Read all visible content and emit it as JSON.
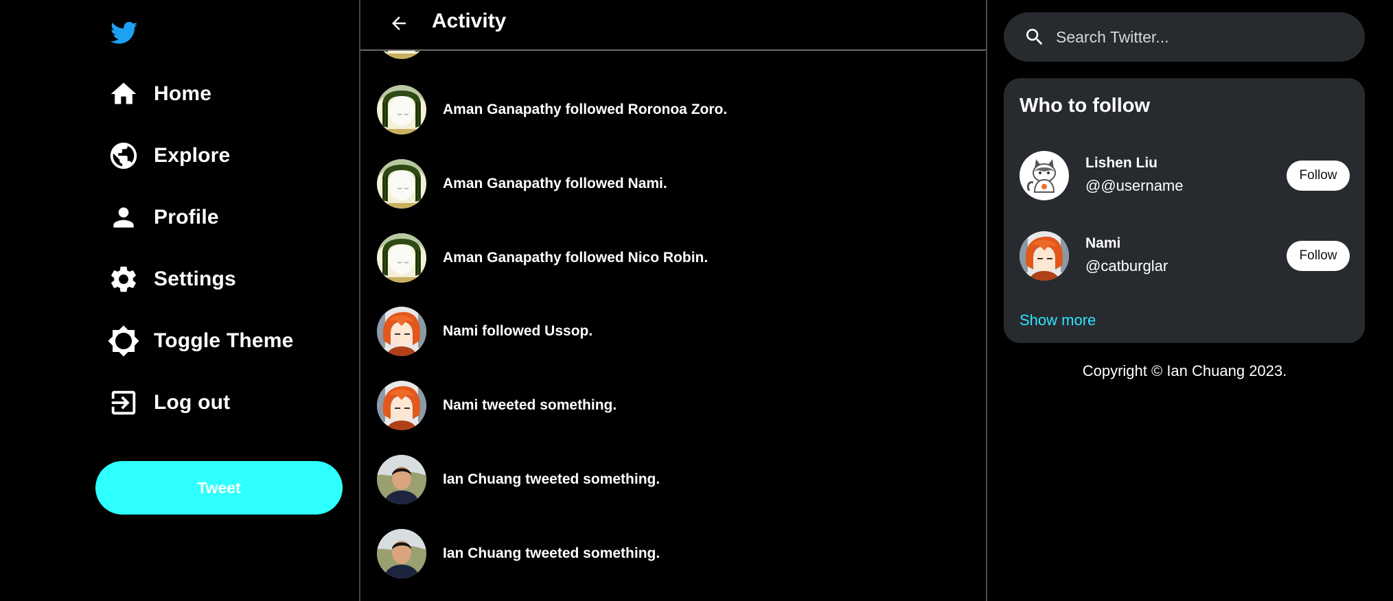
{
  "colors": {
    "background": "#000000",
    "accent": "#2effff",
    "panel": "#272b30",
    "link": "#2ee6ff",
    "logo": "#1da1f2"
  },
  "sidebar": {
    "logo_icon": "twitter-bird-icon",
    "items": [
      {
        "label": "Home",
        "icon": "home-icon"
      },
      {
        "label": "Explore",
        "icon": "globe-icon"
      },
      {
        "label": "Profile",
        "icon": "person-icon"
      },
      {
        "label": "Settings",
        "icon": "gear-icon"
      },
      {
        "label": "Toggle Theme",
        "icon": "brightness-icon"
      },
      {
        "label": "Log out",
        "icon": "logout-icon"
      }
    ],
    "tweet_label": "Tweet"
  },
  "main": {
    "title": "Activity",
    "back_icon": "arrow-left-icon",
    "activities": [
      {
        "text": "Aman Ganapathy followed Roronoa Zoro.",
        "avatar": "aman-avatar"
      },
      {
        "text": "Aman Ganapathy followed Nami.",
        "avatar": "aman-avatar"
      },
      {
        "text": "Aman Ganapathy followed Nico Robin.",
        "avatar": "aman-avatar"
      },
      {
        "text": "Nami followed Ussop.",
        "avatar": "nami-avatar"
      },
      {
        "text": "Nami tweeted something.",
        "avatar": "nami-avatar"
      },
      {
        "text": "Ian Chuang tweeted something.",
        "avatar": "ian-avatar"
      },
      {
        "text": "Ian Chuang tweeted something.",
        "avatar": "ian-avatar"
      }
    ]
  },
  "search": {
    "placeholder": "Search Twitter..."
  },
  "who_to_follow": {
    "title": "Who to follow",
    "users": [
      {
        "name": "Lishen Liu",
        "handle": "@@username",
        "button": "Follow",
        "avatar": "cat-avatar"
      },
      {
        "name": "Nami",
        "handle": "@catburglar",
        "button": "Follow",
        "avatar": "nami-avatar"
      }
    ],
    "show_more": "Show more"
  },
  "footer": {
    "copyright": "Copyright © Ian Chuang 2023."
  }
}
